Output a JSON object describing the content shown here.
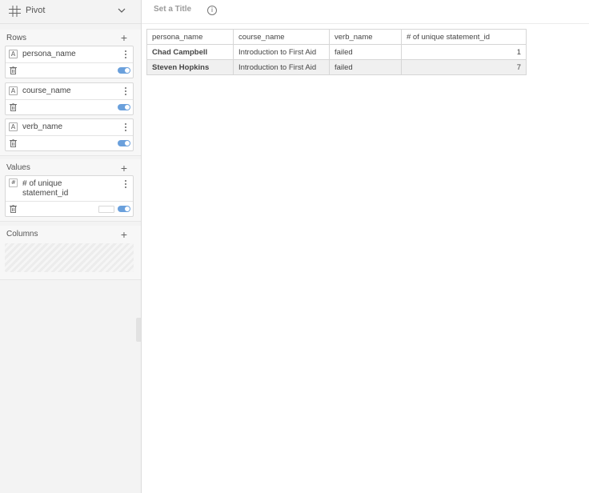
{
  "sidebar": {
    "viz_title": "Pivot",
    "rows": {
      "label": "Rows",
      "fields": [
        {
          "name": "persona_name",
          "type": "A"
        },
        {
          "name": "course_name",
          "type": "A"
        },
        {
          "name": "verb_name",
          "type": "A"
        }
      ]
    },
    "values": {
      "label": "Values",
      "fields": [
        {
          "name_line1": "# of unique",
          "name_line2": "statement_id",
          "type": "#"
        }
      ]
    },
    "columns": {
      "label": "Columns"
    },
    "add_symbol": "+",
    "colors": {
      "toggle": "#6aa0dc"
    }
  },
  "main": {
    "title_placeholder": "Set a Title",
    "info_symbol": "i",
    "table": {
      "headers": [
        "persona_name",
        "course_name",
        "verb_name",
        "# of unique statement_id"
      ],
      "rows": [
        [
          "Chad Campbell",
          "Introduction to First Aid",
          "failed",
          "1"
        ],
        [
          "Steven Hopkins",
          "Introduction to First Aid",
          "failed",
          "7"
        ]
      ]
    }
  }
}
